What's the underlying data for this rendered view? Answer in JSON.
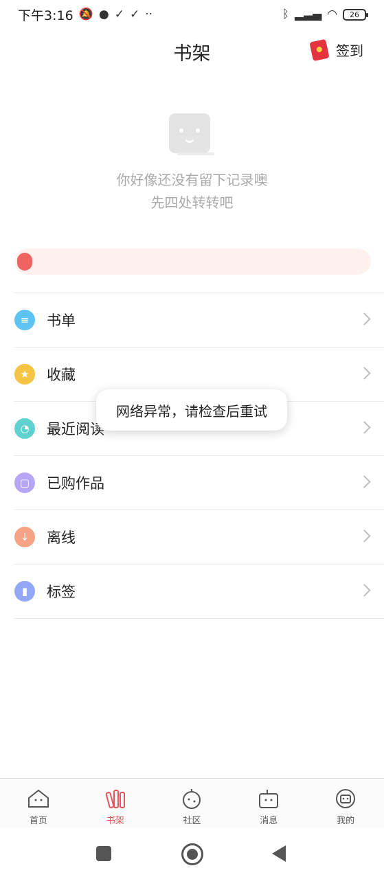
{
  "status_bar": {
    "time": "下午3:16",
    "icons_left": [
      "mute-icon",
      "chat-icon",
      "check-icon",
      "check-icon",
      "dots-icon"
    ],
    "icons_right": [
      "bluetooth-icon",
      "signal-icon",
      "wifi-icon",
      "battery-icon"
    ],
    "battery": "26"
  },
  "header": {
    "title": "书架",
    "signin_label": "签到"
  },
  "empty_state": {
    "line1": "你好像还没有留下记录噢",
    "line2": "先四处转转吧"
  },
  "menu": {
    "items": [
      {
        "label": "书单",
        "icon": "layers-icon",
        "color": "#5cc3f2"
      },
      {
        "label": "收藏",
        "icon": "star-icon",
        "color": "#f6c443"
      },
      {
        "label": "最近阅读",
        "icon": "clock-icon",
        "color": "#5fd2cf"
      },
      {
        "label": "已购作品",
        "icon": "square-icon",
        "color": "#b7a6f5"
      },
      {
        "label": "离线",
        "icon": "download-icon",
        "color": "#f6a386"
      },
      {
        "label": "标签",
        "icon": "bookmark-icon",
        "color": "#92a7f5"
      }
    ]
  },
  "toast": {
    "message": "网络异常，请检查后重试"
  },
  "tabbar": {
    "tabs": [
      {
        "label": "首页",
        "icon": "home-icon"
      },
      {
        "label": "书架",
        "icon": "bookshelf-icon",
        "active": true
      },
      {
        "label": "社区",
        "icon": "community-icon"
      },
      {
        "label": "消息",
        "icon": "message-icon"
      },
      {
        "label": "我的",
        "icon": "profile-icon"
      }
    ]
  },
  "colors": {
    "accent": "#e2555a",
    "progress_bg": "#fff1f0",
    "progress_dot": "#ef6461"
  }
}
